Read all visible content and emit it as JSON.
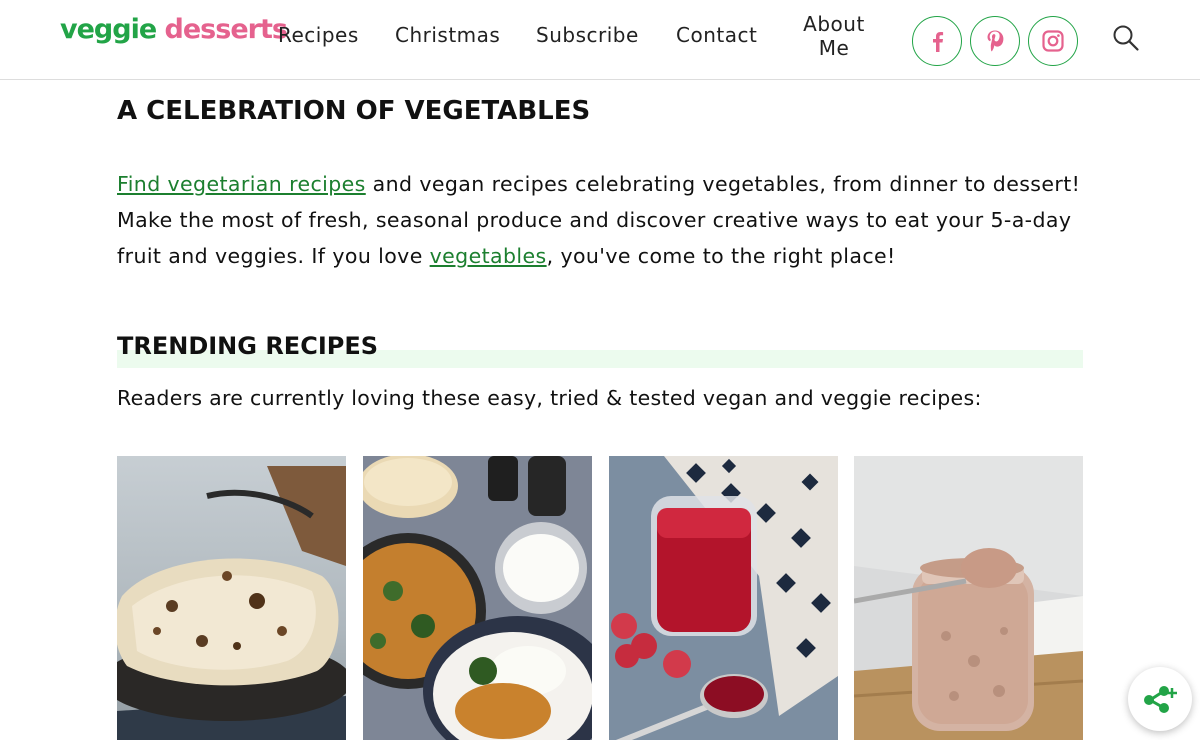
{
  "brand": {
    "part1": "veggie",
    "part2": "desserts"
  },
  "nav": {
    "recipes": "Recipes",
    "christmas": "Christmas",
    "subscribe": "Subscribe",
    "contact": "Contact",
    "about_line1": "About",
    "about_line2": "Me"
  },
  "social": [
    "facebook-icon",
    "pinterest-icon",
    "instagram-icon"
  ],
  "colors": {
    "brand_green": "#22a447",
    "brand_pink": "#e5628e",
    "link_green": "#1c7f2f",
    "highlight": "#ecfbee"
  },
  "main": {
    "heading": "A CELEBRATION OF VEGETABLES",
    "intro_link1": "Find vegetarian recipes",
    "intro_text1": " and vegan recipes celebrating vegetables, from dinner to dessert! Make the most of fresh, seasonal produce and discover creative ways to eat your 5-a-day fruit and veggies. If you love ",
    "intro_link2": "vegetables",
    "intro_text2": ", you've come to the right place!",
    "trending_heading": "TRENDING RECIPES",
    "trending_lead": "Readers are currently loving these easy, tried & tested vegan and veggie recipes:"
  },
  "recipe_cards": [
    "flatbread-photo",
    "dal-curry-photo",
    "raspberry-jam-photo",
    "smoothie-jar-photo"
  ]
}
